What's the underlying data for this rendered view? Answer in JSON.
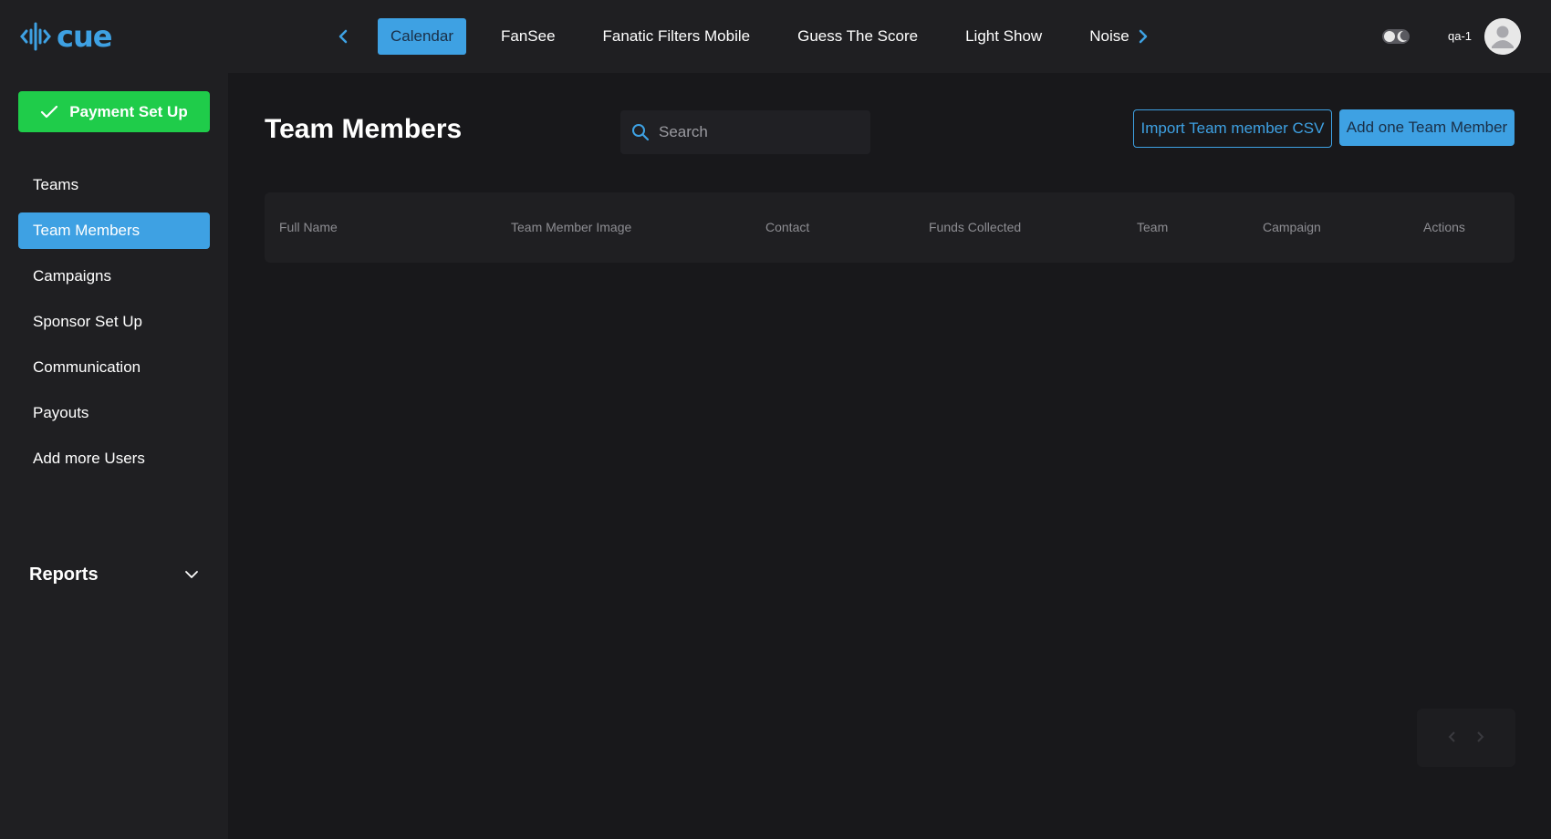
{
  "brand": {
    "name": "cue"
  },
  "topnav": {
    "tabs": [
      {
        "label": "Calendar",
        "active": true
      },
      {
        "label": "FanSee",
        "active": false
      },
      {
        "label": "Fanatic Filters Mobile",
        "active": false
      },
      {
        "label": "Guess The Score",
        "active": false
      },
      {
        "label": "Light Show",
        "active": false
      },
      {
        "label": "Noise",
        "active": false
      }
    ],
    "prev_icon": "chevron-left-icon",
    "next_icon": "chevron-right-icon",
    "theme_toggle_icon": "dark-mode-toggle-icon",
    "user_label": "qa-1",
    "avatar_icon": "user-avatar-icon"
  },
  "sidebar": {
    "payment_button": {
      "label": "Payment Set Up",
      "icon": "check-icon"
    },
    "items": [
      {
        "label": "Teams",
        "active": false
      },
      {
        "label": "Team Members",
        "active": true
      },
      {
        "label": "Campaigns",
        "active": false
      },
      {
        "label": "Sponsor Set Up",
        "active": false
      },
      {
        "label": "Communication",
        "active": false
      },
      {
        "label": "Payouts",
        "active": false
      },
      {
        "label": "Add more Users",
        "active": false
      }
    ],
    "reports": {
      "label": "Reports",
      "icon": "chevron-down-icon"
    }
  },
  "main": {
    "title": "Team Members",
    "search": {
      "placeholder": "Search",
      "value": ""
    },
    "import_button": "Import Team member CSV",
    "add_button": "Add one Team Member",
    "table": {
      "columns": [
        "Full Name",
        "Team Member Image",
        "Contact",
        "Funds Collected",
        "Team",
        "Campaign",
        "Actions"
      ],
      "rows": []
    },
    "pagination": {
      "prev_icon": "chevron-left-icon",
      "next_icon": "chevron-right-icon"
    }
  },
  "colors": {
    "accent": "#3ea1e3",
    "success": "#1fcc4a",
    "background": "#18181b",
    "panel": "#1f1f22"
  }
}
